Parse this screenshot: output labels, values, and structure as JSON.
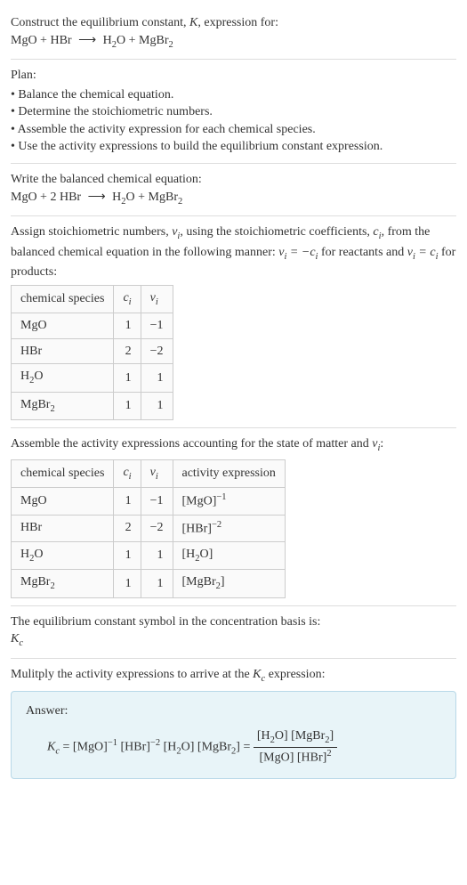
{
  "intro": {
    "line1_a": "Construct the equilibrium constant, ",
    "line1_k": "K",
    "line1_b": ", expression for:",
    "eq1_lhs": "MgO + HBr",
    "eq1_rhs_a": "H",
    "eq1_rhs_b": "O + MgBr",
    "sub2": "2"
  },
  "plan": {
    "title": "Plan:",
    "items": [
      "Balance the chemical equation.",
      "Determine the stoichiometric numbers.",
      "Assemble the activity expression for each chemical species.",
      "Use the activity expressions to build the equilibrium constant expression."
    ]
  },
  "balanced": {
    "title": "Write the balanced chemical equation:",
    "lhs": "MgO + 2 HBr",
    "rhs_a": "H",
    "rhs_b": "O + MgBr",
    "sub2": "2"
  },
  "stoich": {
    "intro_a": "Assign stoichiometric numbers, ",
    "nu_i": "ν",
    "sub_i": "i",
    "intro_b": ", using the stoichiometric coefficients, ",
    "c_i": "c",
    "intro_c": ", from the balanced chemical equation in the following manner: ",
    "eq1_a": "ν",
    "eq1_b": " = −c",
    "intro_d": " for reactants and ",
    "eq2_a": "ν",
    "eq2_b": " = c",
    "intro_e": " for products:",
    "headers": {
      "species": "chemical species",
      "ci": "c",
      "nui": "ν",
      "sub_i": "i"
    },
    "rows": [
      {
        "species_a": "MgO",
        "species_sub": "",
        "ci": "1",
        "nui": "−1"
      },
      {
        "species_a": "HBr",
        "species_sub": "",
        "ci": "2",
        "nui": "−2"
      },
      {
        "species_a": "H",
        "species_sub": "2",
        "species_b": "O",
        "ci": "1",
        "nui": "1"
      },
      {
        "species_a": "MgBr",
        "species_sub": "2",
        "species_b": "",
        "ci": "1",
        "nui": "1"
      }
    ]
  },
  "activity": {
    "intro_a": "Assemble the activity expressions accounting for the state of matter and ",
    "nu": "ν",
    "sub_i": "i",
    "colon": ":",
    "headers": {
      "species": "chemical species",
      "ci": "c",
      "nui": "ν",
      "act": "activity expression",
      "sub_i": "i"
    },
    "rows": [
      {
        "sp_a": "MgO",
        "sp_sub": "",
        "sp_b": "",
        "ci": "1",
        "nui": "−1",
        "act_base": "[MgO]",
        "act_sup": "−1"
      },
      {
        "sp_a": "HBr",
        "sp_sub": "",
        "sp_b": "",
        "ci": "2",
        "nui": "−2",
        "act_base": "[HBr]",
        "act_sup": "−2"
      },
      {
        "sp_a": "H",
        "sp_sub": "2",
        "sp_b": "O",
        "ci": "1",
        "nui": "1",
        "act_base_a": "[H",
        "act_base_b": "O]",
        "act_sub": "2",
        "act_sup": ""
      },
      {
        "sp_a": "MgBr",
        "sp_sub": "2",
        "sp_b": "",
        "ci": "1",
        "nui": "1",
        "act_base_a": "[MgBr",
        "act_base_b": "]",
        "act_sub": "2",
        "act_sup": ""
      }
    ]
  },
  "symbol": {
    "line1": "The equilibrium constant symbol in the concentration basis is:",
    "kc_a": "K",
    "kc_sub": "c"
  },
  "multiply": {
    "intro_a": "Mulitply the activity expressions to arrive at the ",
    "kc_a": "K",
    "kc_sub": "c",
    "intro_b": " expression:"
  },
  "answer": {
    "label": "Answer:",
    "lhs_a": "K",
    "lhs_sub": "c",
    "eq": " = ",
    "t1": "[MgO]",
    "t1_sup": "−1",
    "sp": " ",
    "t2": "[HBr]",
    "t2_sup": "−2",
    "t3_a": "[H",
    "t3_sub": "2",
    "t3_b": "O]",
    "t4_a": "[MgBr",
    "t4_sub": "2",
    "t4_b": "]",
    "frac_num_a": "[H",
    "frac_num_b": "O] [MgBr",
    "frac_num_c": "]",
    "frac_den_a": "[MgO] [HBr]",
    "frac_den_sup": "2"
  }
}
